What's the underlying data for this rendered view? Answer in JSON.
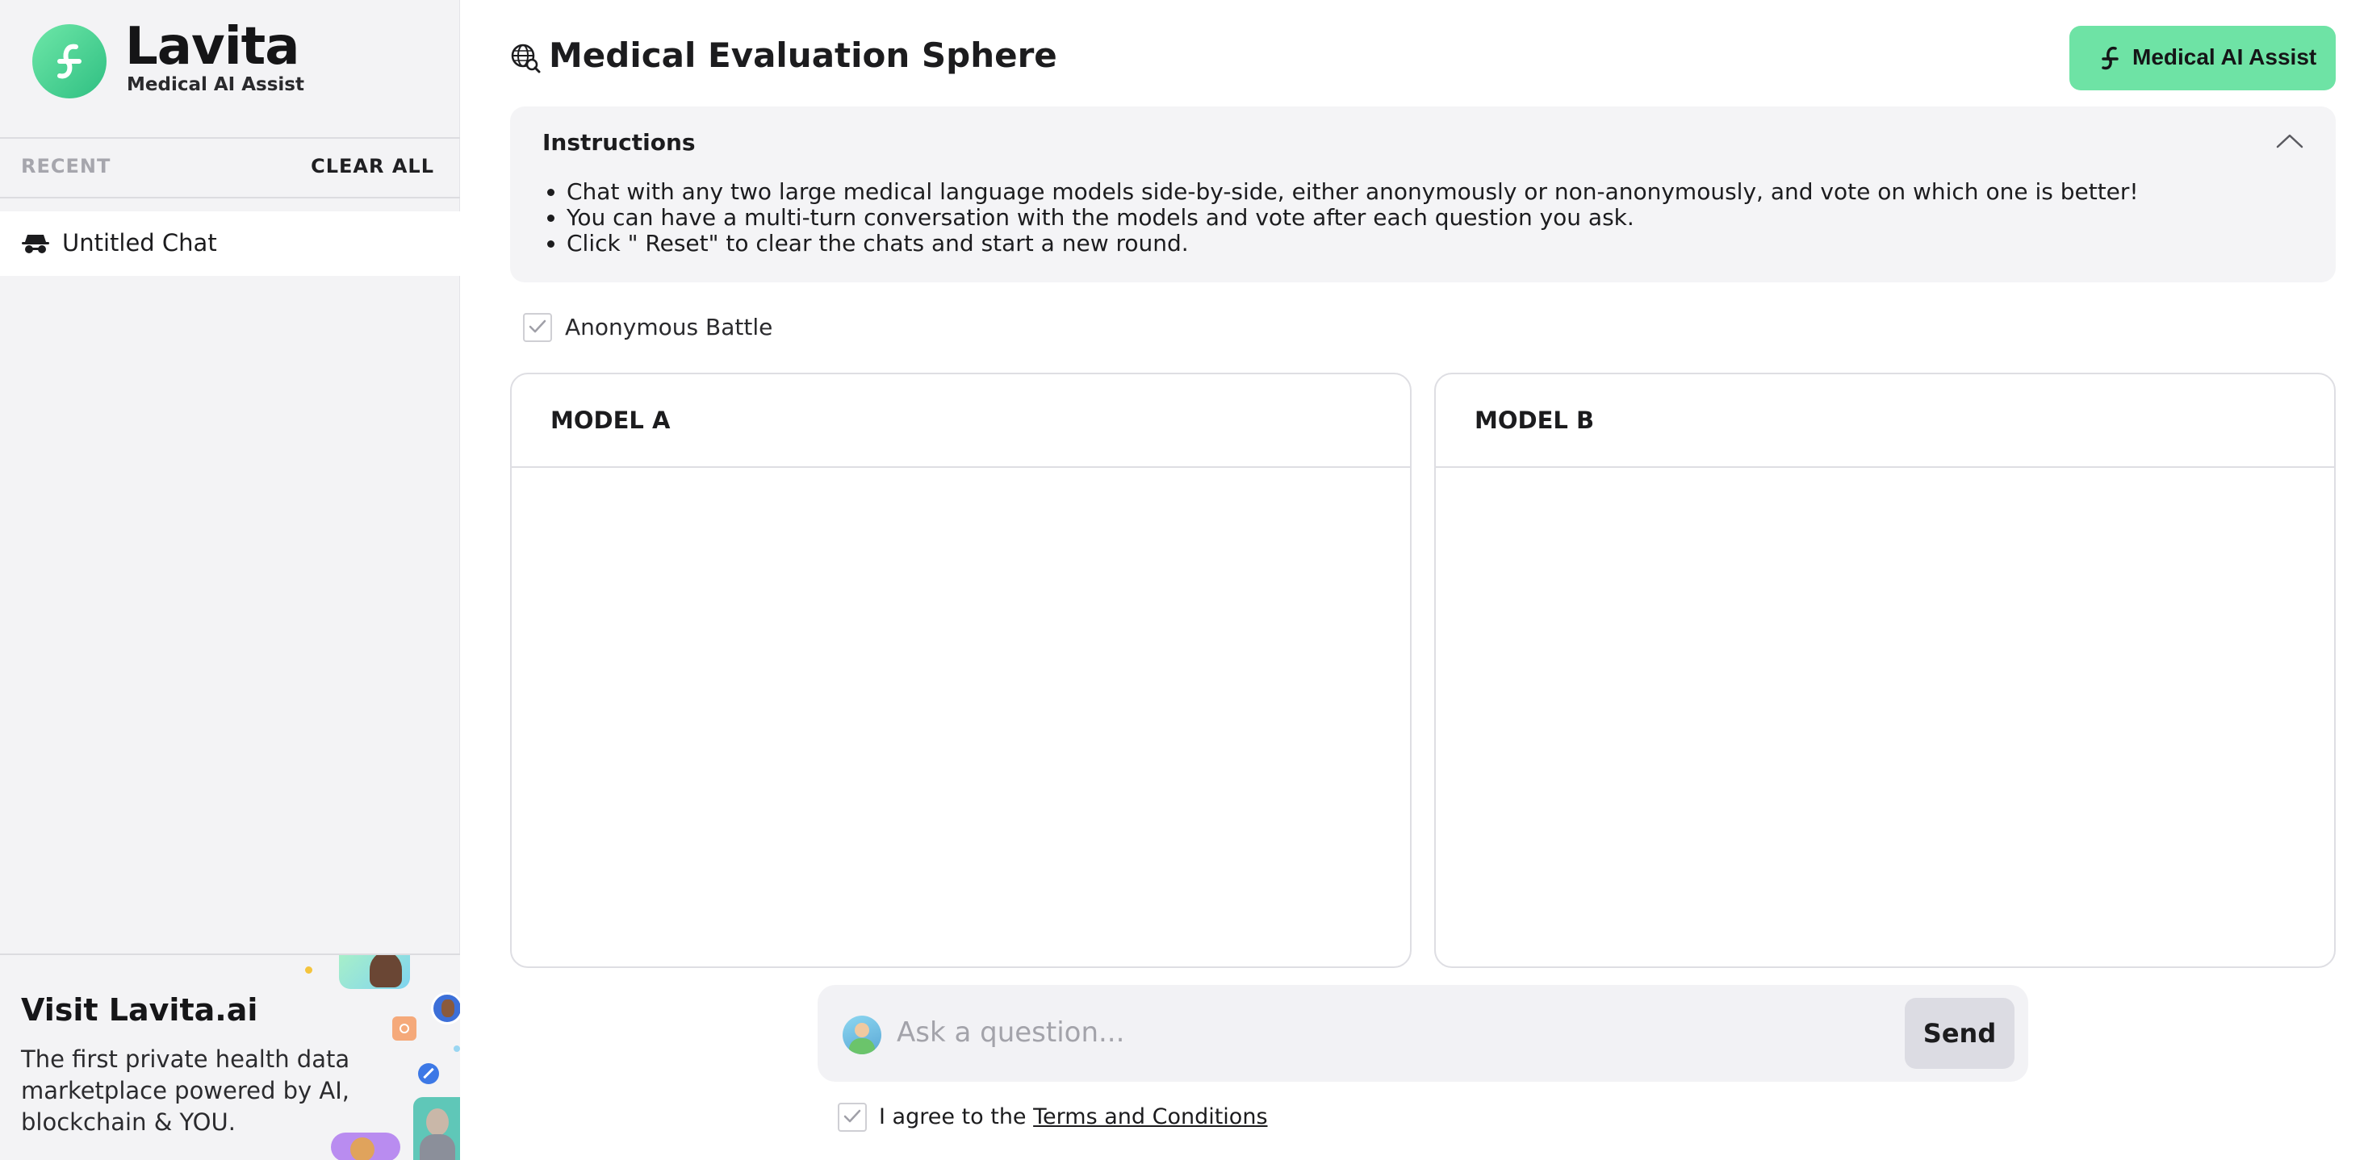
{
  "brand": {
    "name": "Lavita",
    "subtitle": "Medical AI Assist",
    "accent": "#5fdc9c"
  },
  "sidebar": {
    "recent_label": "RECENT",
    "clear_all_label": "CLEAR ALL",
    "chats": [
      {
        "label": "Untitled Chat",
        "icon": "incognito-icon"
      }
    ],
    "promo": {
      "title": "Visit Lavita.ai",
      "text": "The first private health data marketplace powered by AI, blockchain & YOU."
    }
  },
  "header": {
    "title": "Medical Evaluation Sphere",
    "title_icon": "globe-search-icon",
    "assist_button_label": "Medical AI Assist",
    "assist_button_color": "#6ee3a5"
  },
  "instructions": {
    "title": "Instructions",
    "expanded": true,
    "items": [
      "Chat with any two large medical language models side-by-side, either anonymously or non-anonymously, and vote on which one is better!",
      "You can have a multi-turn conversation with the models and vote after each question you ask.",
      "Click \" Reset\" to clear the chats and start a new round."
    ]
  },
  "battle": {
    "anonymous_label": "Anonymous Battle",
    "anonymous_checked": true
  },
  "panels": {
    "model_a_title": "MODEL A",
    "model_b_title": "MODEL B"
  },
  "composer": {
    "placeholder": "Ask a question...",
    "value": "",
    "send_label": "Send",
    "terms_prefix": "I agree to the ",
    "terms_link": "Terms and Conditions",
    "terms_checked": true
  }
}
